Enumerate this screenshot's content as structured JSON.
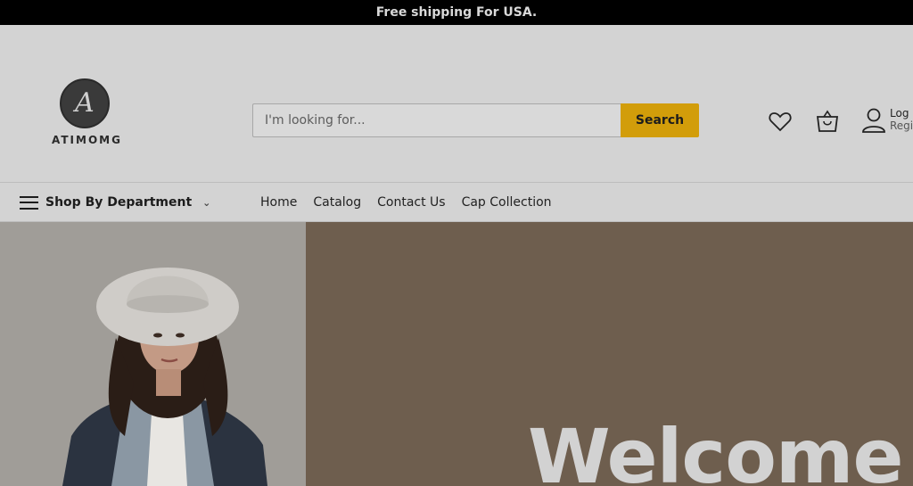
{
  "announcement": {
    "text": "Free shipping For USA."
  },
  "brand": {
    "logo_letter": "A",
    "name": "ATIMOMG"
  },
  "search": {
    "placeholder": "I'm looking for...",
    "button_label": "Search"
  },
  "header_icons": {
    "wishlist": "heart-icon",
    "cart": "shopping-bag-icon",
    "account": "user-icon"
  },
  "account": {
    "login_label": "Log",
    "register_label": "Regi"
  },
  "nav": {
    "department_label": "Shop By Department",
    "links": [
      "Home",
      "Catalog",
      "Contact Us",
      "Cap Collection"
    ]
  },
  "hero": {
    "headline": "Welcome"
  },
  "colors": {
    "announcement_bg": "#000000",
    "accent": "#d29d0a",
    "hero_brown": "#6e5e4e"
  }
}
